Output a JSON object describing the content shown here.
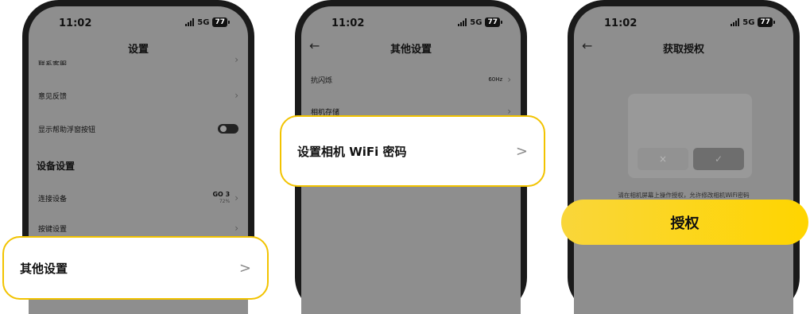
{
  "status": {
    "time": "11:02",
    "network": "5G",
    "battery": "77"
  },
  "phone1": {
    "title": "设置",
    "partial_row": "联系客服",
    "rows": [
      {
        "label": "意见反馈"
      },
      {
        "label": "显示帮助浮窗按钮"
      }
    ],
    "section": "设备设置",
    "device_row": {
      "label": "连接设备",
      "model": "GO 3",
      "percent": "72%"
    },
    "button_row": {
      "label": "按键设置"
    },
    "callout": {
      "label": "其他设置",
      "arrow": ">"
    }
  },
  "phone2": {
    "title": "其他设置",
    "back": "←",
    "rows": [
      {
        "label": "抗闪烁",
        "value": "60Hz"
      },
      {
        "label": "相机存储"
      }
    ],
    "callout": {
      "label": "设置相机 WiFi 密码",
      "arrow": ">"
    }
  },
  "phone3": {
    "title": "获取授权",
    "back": "←",
    "cancel_symbol": "×",
    "ok_symbol": "✓",
    "hint": "请在相机屏幕上操作授权，允许修改相机WiFi密码",
    "authorize_label": "授权"
  }
}
